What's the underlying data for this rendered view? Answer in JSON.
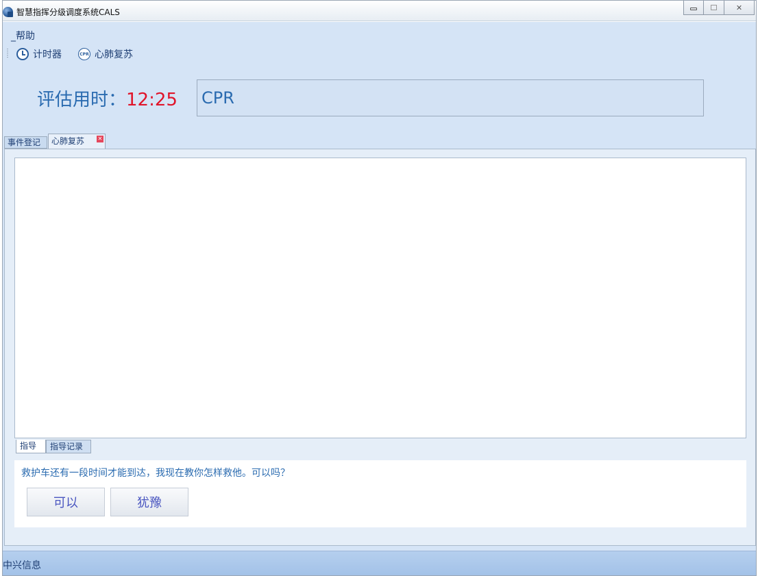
{
  "window": {
    "title": "智慧指挥分级调度系统CALS",
    "controls": {
      "minimize": "",
      "maximize": "",
      "close": "✕"
    }
  },
  "menu": {
    "help": "_帮助"
  },
  "toolbar": {
    "timer_label": "计时器",
    "cpr_label": "心肺复苏",
    "cpr_icon_text": "CPR"
  },
  "assessment": {
    "label": "评估用时：",
    "time": "12:25",
    "protocol": "CPR"
  },
  "tabs": {
    "events": "事件登记",
    "cpr": "心肺复苏",
    "close_glyph": "✕"
  },
  "inner_tabs": {
    "guide": "指导",
    "record": "指导记录"
  },
  "dialog": {
    "question": "救护车还有一段时间才能到达，我现在教你怎样救他。可以吗？",
    "yes": "可以",
    "hesitate": "犹豫"
  },
  "status": {
    "company": "中兴信息"
  },
  "colors": {
    "accent_blue": "#2a6bb0",
    "timer_red": "#e0142a",
    "client_bg": "#d5e4f6"
  }
}
